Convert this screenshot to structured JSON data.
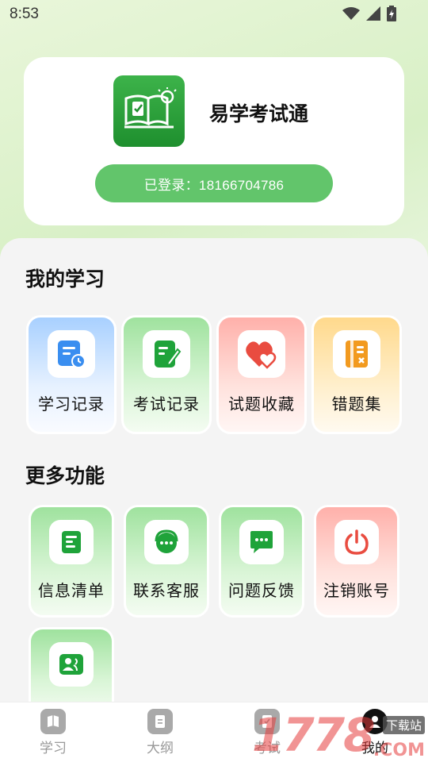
{
  "status_bar": {
    "time": "8:53"
  },
  "profile": {
    "app_name": "易学考试通",
    "login_status": "已登录：18166704786"
  },
  "my_learning": {
    "title": "我的学习",
    "items": [
      {
        "label": "学习记录",
        "icon": "study-record-icon"
      },
      {
        "label": "考试记录",
        "icon": "exam-record-icon"
      },
      {
        "label": "试题收藏",
        "icon": "favorites-heart-icon"
      },
      {
        "label": "错题集",
        "icon": "wrong-questions-icon"
      }
    ]
  },
  "more_features": {
    "title": "更多功能",
    "items": [
      {
        "label": "信息清单",
        "icon": "info-list-icon"
      },
      {
        "label": "联系客服",
        "icon": "customer-service-icon"
      },
      {
        "label": "问题反馈",
        "icon": "feedback-icon"
      },
      {
        "label": "注销账号",
        "icon": "power-icon"
      },
      {
        "label": "",
        "icon": "users-icon"
      }
    ]
  },
  "tab_bar": {
    "items": [
      {
        "label": "学习",
        "active": false
      },
      {
        "label": "大纲",
        "active": false
      },
      {
        "label": "考试",
        "active": false
      },
      {
        "label": "我的",
        "active": true
      }
    ]
  },
  "watermark": {
    "digits": "1778",
    "text": "下载站",
    "suffix": ".COM"
  },
  "colors": {
    "brand_green": "#62c56b",
    "icon_blue": "#3a8ef0",
    "icon_green": "#1fa33a",
    "icon_red": "#e94c40",
    "icon_orange": "#f29a1f"
  }
}
